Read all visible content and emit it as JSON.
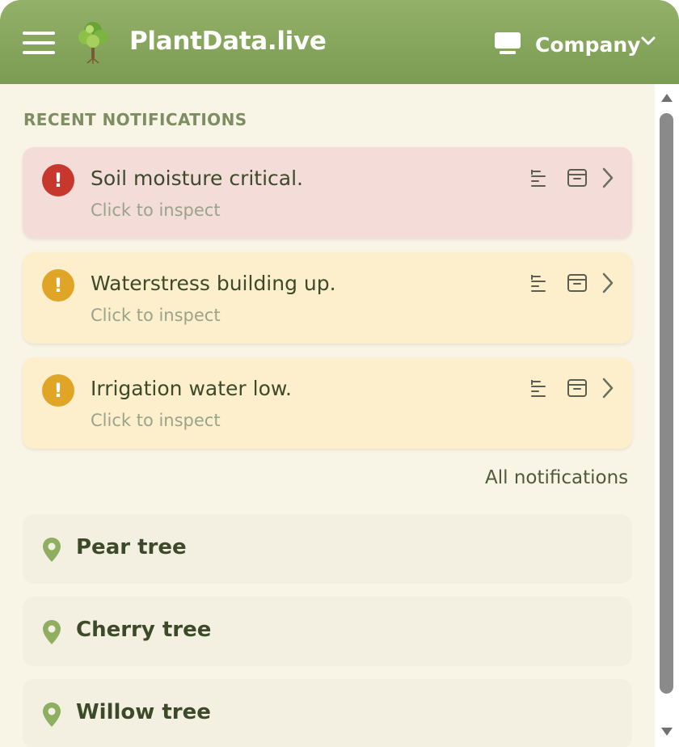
{
  "header": {
    "title": "PlantData.live",
    "menu_icon": "hamburger-menu-icon",
    "logo_icon": "tree-logo-icon",
    "company_icon": "monitor-icon",
    "company_label": "Company",
    "company_chevron": "chevron-down-icon",
    "color": "#85a55b"
  },
  "notifications": {
    "section_label": "RECENT NOTIFICATIONS",
    "items": [
      {
        "title": "Soil moisture critical.",
        "subtitle": "Click to inspect",
        "severity": "critical",
        "badge": "!",
        "color": "#c8372d"
      },
      {
        "title": "Waterstress building up.",
        "subtitle": "Click to inspect",
        "severity": "warning",
        "badge": "!",
        "color": "#e0a527"
      },
      {
        "title": "Irrigation water low.",
        "subtitle": "Click to inspect",
        "severity": "warning",
        "badge": "!",
        "color": "#e0a527"
      }
    ],
    "actions": [
      "sort-icon",
      "archive-icon",
      "chevron-right-icon"
    ],
    "all_link": "All notifications"
  },
  "locations": {
    "icon": "map-pin-icon",
    "items": [
      {
        "label": "Pear tree"
      },
      {
        "label": "Cherry tree"
      },
      {
        "label": "Willow tree"
      }
    ]
  }
}
